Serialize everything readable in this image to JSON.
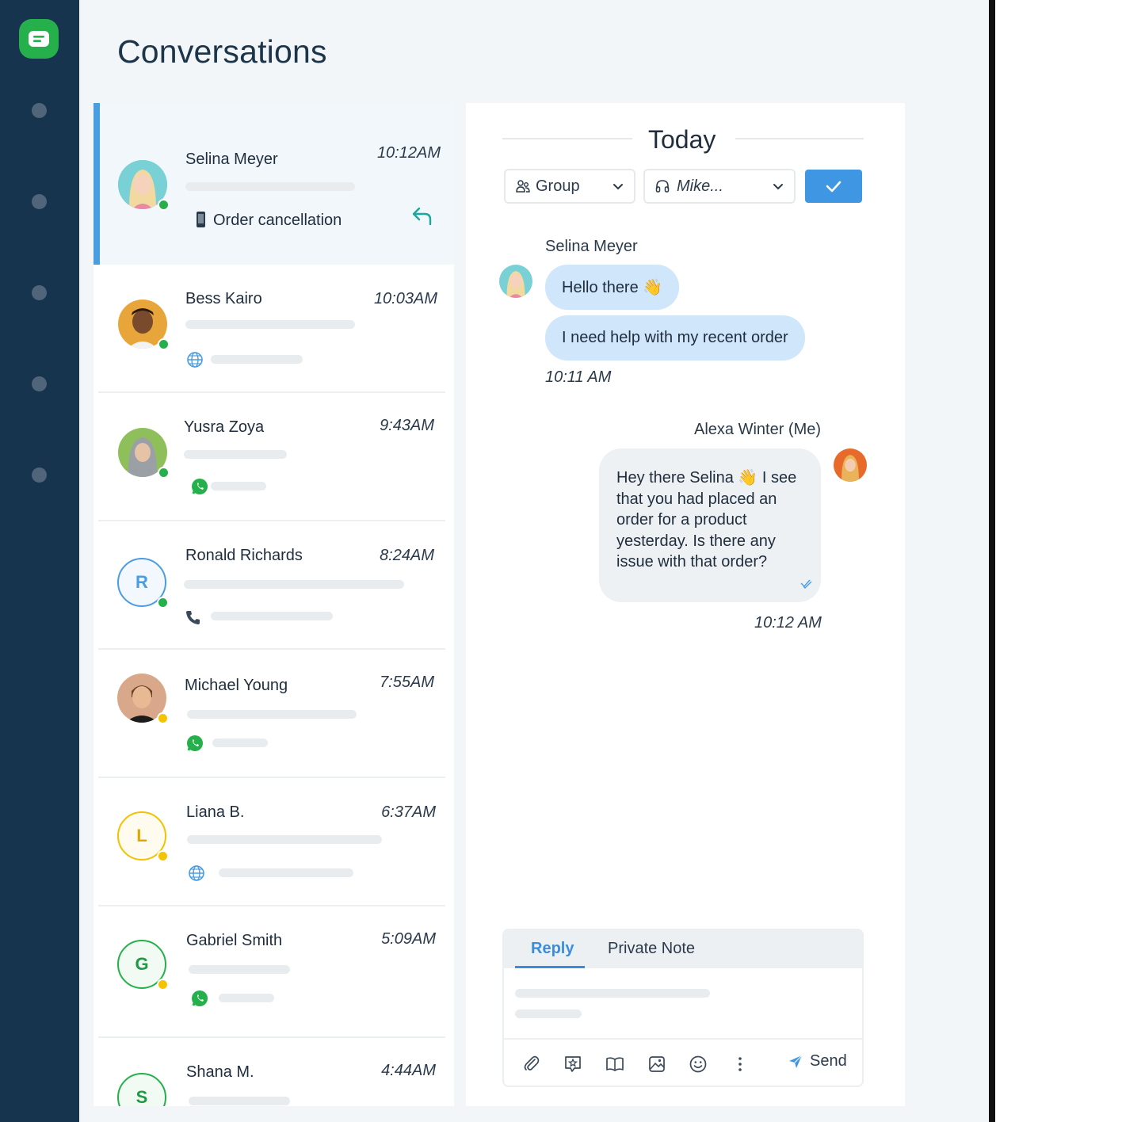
{
  "page": {
    "title": "Conversations"
  },
  "sidebar": {
    "nav_items": 5
  },
  "conversations": [
    {
      "name": "Selina Meyer",
      "time": "10:12AM",
      "subject": "Order cancellation",
      "status": "online",
      "channel": "phone-icon",
      "avatar": "photo"
    },
    {
      "name": "Bess Kairo",
      "time": "10:03AM",
      "status": "online",
      "channel": "globe-icon",
      "avatar": "photo"
    },
    {
      "name": "Yusra Zoya",
      "time": "9:43AM",
      "status": "online",
      "channel": "whatsapp-icon",
      "avatar": "photo"
    },
    {
      "name": "Ronald Richards",
      "time": "8:24AM",
      "status": "online",
      "channel": "phone-icon",
      "avatar_letter": "R"
    },
    {
      "name": "Michael Young",
      "time": "7:55AM",
      "status": "away",
      "channel": "whatsapp-icon",
      "avatar": "photo"
    },
    {
      "name": "Liana B.",
      "time": "6:37AM",
      "status": "away",
      "channel": "globe-icon",
      "avatar_letter": "L"
    },
    {
      "name": "Gabriel Smith",
      "time": "5:09AM",
      "status": "away",
      "channel": "whatsapp-icon",
      "avatar_letter": "G"
    },
    {
      "name": "Shana M.",
      "time": "4:44AM",
      "status": "online",
      "channel": "none",
      "avatar_letter": "S"
    }
  ],
  "chat": {
    "date_divider": "Today",
    "group_select": "Group",
    "agent_select": "Mike...",
    "incoming": {
      "sender": "Selina Meyer",
      "messages": [
        "Hello there 👋",
        "I need help with my recent order"
      ],
      "time": "10:11 AM"
    },
    "outgoing": {
      "sender": "Alexa Winter (Me)",
      "message": "Hey there Selina 👋 I see that you had placed an order for a product yesterday. Is there any issue with that order?",
      "time": "10:12 AM"
    }
  },
  "composer": {
    "tab_reply": "Reply",
    "tab_note": "Private Note",
    "send_label": "Send"
  },
  "colors": {
    "sidebar": "#17344f",
    "accent": "#3f97e3",
    "online": "#25b04b",
    "away": "#f5c400",
    "incoming_bubble": "#cfe6fb"
  }
}
